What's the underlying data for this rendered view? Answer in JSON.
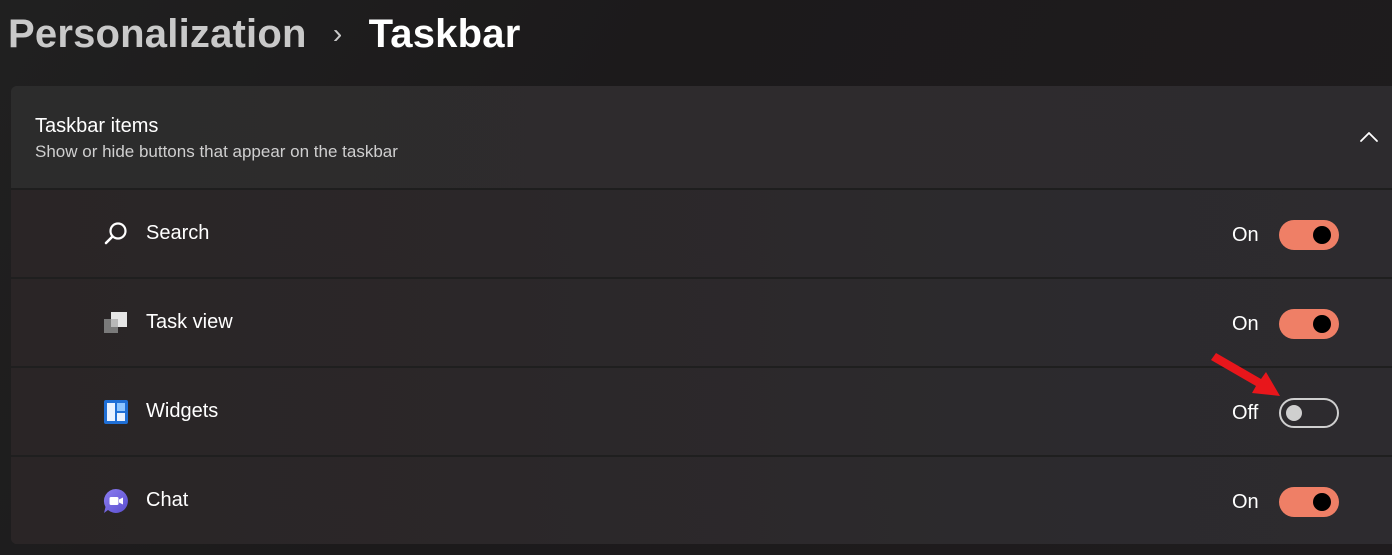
{
  "breadcrumb": {
    "parent": "Personalization",
    "separator": "›",
    "current": "Taskbar"
  },
  "section": {
    "title": "Taskbar items",
    "subtitle": "Show or hide buttons that appear on the taskbar",
    "expanded": true
  },
  "items": [
    {
      "label": "Search",
      "state": "On",
      "icon": "search-icon"
    },
    {
      "label": "Task view",
      "state": "On",
      "icon": "task-view-icon"
    },
    {
      "label": "Widgets",
      "state": "Off",
      "icon": "widgets-icon"
    },
    {
      "label": "Chat",
      "state": "On",
      "icon": "chat-icon"
    }
  ],
  "colors": {
    "accent": "#ef7f66",
    "annotation_arrow": "#e8161b"
  }
}
